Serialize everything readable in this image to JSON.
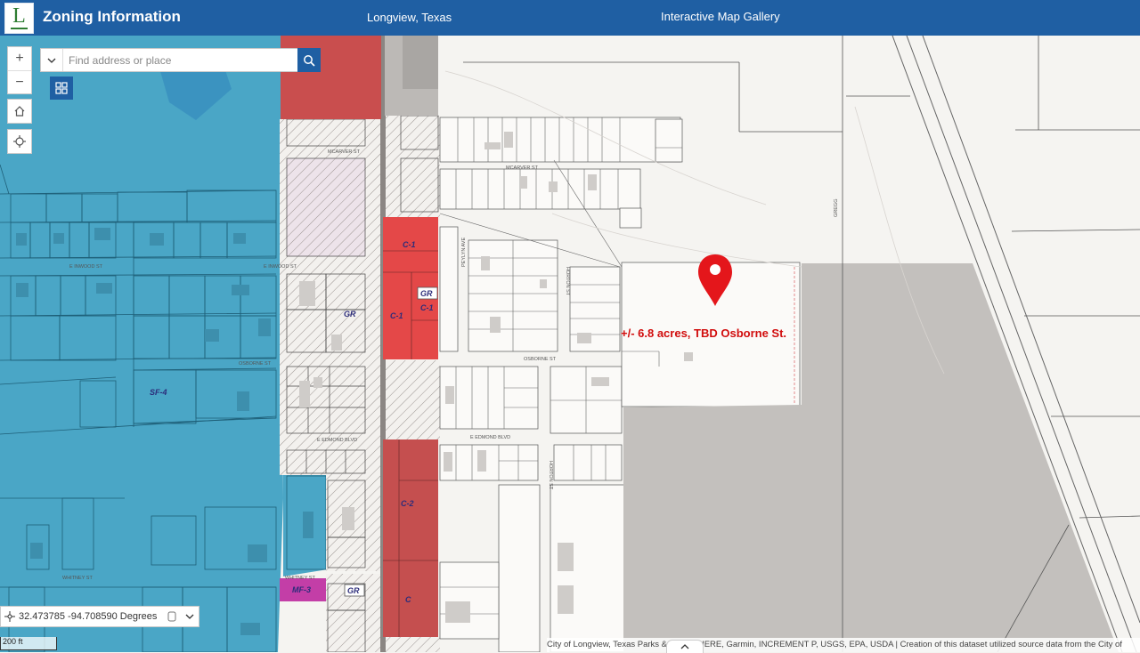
{
  "header": {
    "logo_letter": "L",
    "title": "Zoning Information",
    "city": "Longview, Texas",
    "gallery_link": "Interactive Map Gallery"
  },
  "search": {
    "placeholder": "Find address or place"
  },
  "controls": {
    "zoom_in": "+",
    "zoom_out": "−"
  },
  "coordinates": {
    "text": "32.473785 -94.708590 Degrees"
  },
  "scale": {
    "label": "200 ft"
  },
  "attribution": {
    "text": "City of Longview, Texas Parks & ... Esri, HERE, Garmin, INCREMENT P, USGS, EPA, USDA | Creation of this dataset utilized source data from the City of"
  },
  "map": {
    "callout": "+/- 6.8 acres, TBD Osborne St.",
    "zones": [
      "C-1",
      "GR",
      "C-1",
      "C-1",
      "GR",
      "SF-4",
      "C-2",
      "C",
      "MF-3",
      "GR"
    ],
    "streets": [
      "MCARVER ST",
      "E INWOOD ST",
      "OSBORNE ST",
      "E EDMOND BLVD",
      "HORTON ST",
      "PEYLYN AVE",
      "GREGG",
      "WHITNEY ST"
    ]
  },
  "colors": {
    "header": "#1f5fa3",
    "zone_sf": "#4ba8c7",
    "zone_c": "#cc4f4f",
    "zone_c1": "#e34b4b",
    "zone_mf": "#c03ca6",
    "pin": "#e4161b",
    "grey_parcel": "#c3c0bd"
  }
}
